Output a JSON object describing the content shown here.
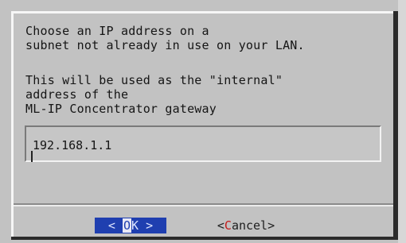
{
  "dialog": {
    "message_lines": [
      "Choose an IP address on a",
      "subnet not already in use on your LAN.",
      "This will be used as the \"internal\"",
      "address of the",
      "ML-IP Concentrator gateway"
    ],
    "ip_input": {
      "value": "192.168.1.1"
    },
    "buttons": {
      "ok": {
        "left": "<",
        "hotkey": "O",
        "rest": "K",
        "right": ">"
      },
      "cancel": {
        "left": "<",
        "hotkey": "C",
        "rest": "ancel",
        "right": ">"
      }
    },
    "colors": {
      "background": "#c2c2c2",
      "focus_button": "#1f3fb0",
      "hotkey_red": "#c41a1a"
    }
  }
}
